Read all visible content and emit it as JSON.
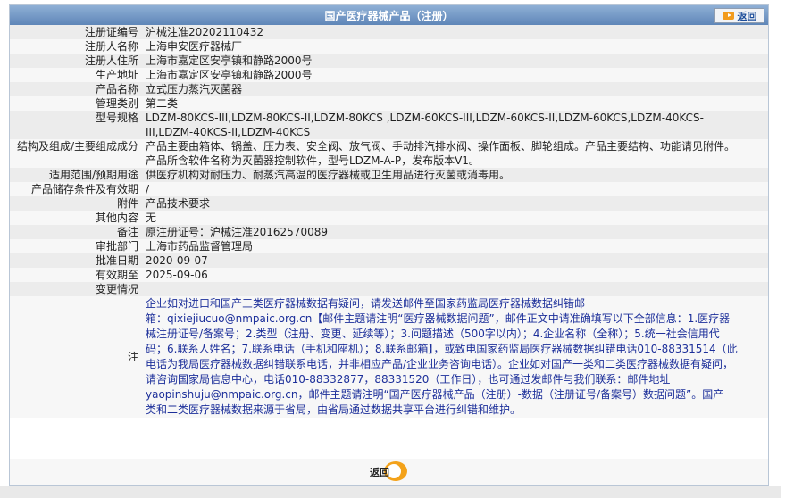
{
  "header": {
    "title": "国产医疗器械产品（注册）",
    "back_label": "返回"
  },
  "rows": [
    {
      "label": "注册证编号",
      "lines": [
        "沪械注准20202110432"
      ]
    },
    {
      "label": "注册人名称",
      "lines": [
        "上海申安医疗器械厂"
      ]
    },
    {
      "label": "注册人住所",
      "lines": [
        "上海市嘉定区安亭镇和静路2000号"
      ]
    },
    {
      "label": "生产地址",
      "lines": [
        "上海市嘉定区安亭镇和静路2000号"
      ]
    },
    {
      "label": "产品名称",
      "lines": [
        "立式压力蒸汽灭菌器"
      ]
    },
    {
      "label": "管理类别",
      "lines": [
        "第二类"
      ]
    },
    {
      "label": "型号规格",
      "lines": [
        "LDZM-80KCS-III,LDZM-80KCS-II,LDZM-80KCS ,LDZM-60KCS-III,LDZM-60KCS-II,LDZM-60KCS,LDZM-40KCS-",
        "III,LDZM-40KCS-II,LDZM-40KCS"
      ]
    },
    {
      "label": "结构及组成/主要组成成分",
      "lines": [
        "产品主要由箱体、锅盖、压力表、安全阀、放气阀、手动排汽排水阀、操作面板、脚轮组成。产品主要结构、功能请见附件。",
        "产品所含软件名称为灭菌器控制软件，型号LDZM-A-P，发布版本V1。"
      ]
    },
    {
      "label": "适用范围/预期用途",
      "lines": [
        "供医疗机构对耐压力、耐蒸汽高温的医疗器械或卫生用品进行灭菌或消毒用。"
      ]
    },
    {
      "label": "产品储存条件及有效期",
      "lines": [
        "/"
      ]
    },
    {
      "label": "附件",
      "lines": [
        "产品技术要求"
      ]
    },
    {
      "label": "其他内容",
      "lines": [
        "无"
      ]
    },
    {
      "label": "备注",
      "lines": [
        "原注册证号：沪械注准20162570089"
      ]
    },
    {
      "label": "审批部门",
      "lines": [
        "上海市药品监督管理局"
      ]
    },
    {
      "label": "批准日期",
      "lines": [
        "2020-09-07"
      ]
    },
    {
      "label": "有效期至",
      "lines": [
        "2025-09-06"
      ]
    },
    {
      "label": "变更情况",
      "lines": [
        ""
      ]
    }
  ],
  "note": {
    "label": "注",
    "lines": [
      "企业如对进口和国产三类医疗器械数据有疑问，请发送邮件至国家药监局医疗器械数据纠错邮",
      "箱：qixiejiucuo@nmpaic.org.cn【邮件主题请注明“医疗器械数据问题”，邮件正文中请准确填写以下全部信息：1.医疗器",
      "械注册证号/备案号；2.类型（注册、变更、延续等）；3.问题描述（500字以内）；4.企业名称（全称）；5.统一社会信用代",
      "码；6.联系人姓名；7.联系电话（手机和座机）；8.联系邮箱】，或致电国家药监局医疗器械数据纠错电话010-88331514（此",
      "电话为我局医疗器械数据纠错联系电话，并非相应产品/企业业务咨询电话）。企业如对国产一类和二类医疗器械数据有疑问，",
      "请咨询国家局信息中心，电话010-88332877，88331520（工作日），也可通过发邮件与我们联系：邮件地址",
      "yaopinshuju@nmpaic.org.cn，邮件主题请注明“国产医疗器械产品（注册）-数据（注册证号/备案号）数据问题”。国产一",
      "类和二类医疗器械数据来源于省局，由省局通过数据共享平台进行纠错和维护。"
    ]
  },
  "footer": {
    "back_label": "返回"
  },
  "colors": {
    "titlebar": "#6f95c4",
    "note_text": "#1c2f9a",
    "back_ring": "#f3a21a"
  }
}
